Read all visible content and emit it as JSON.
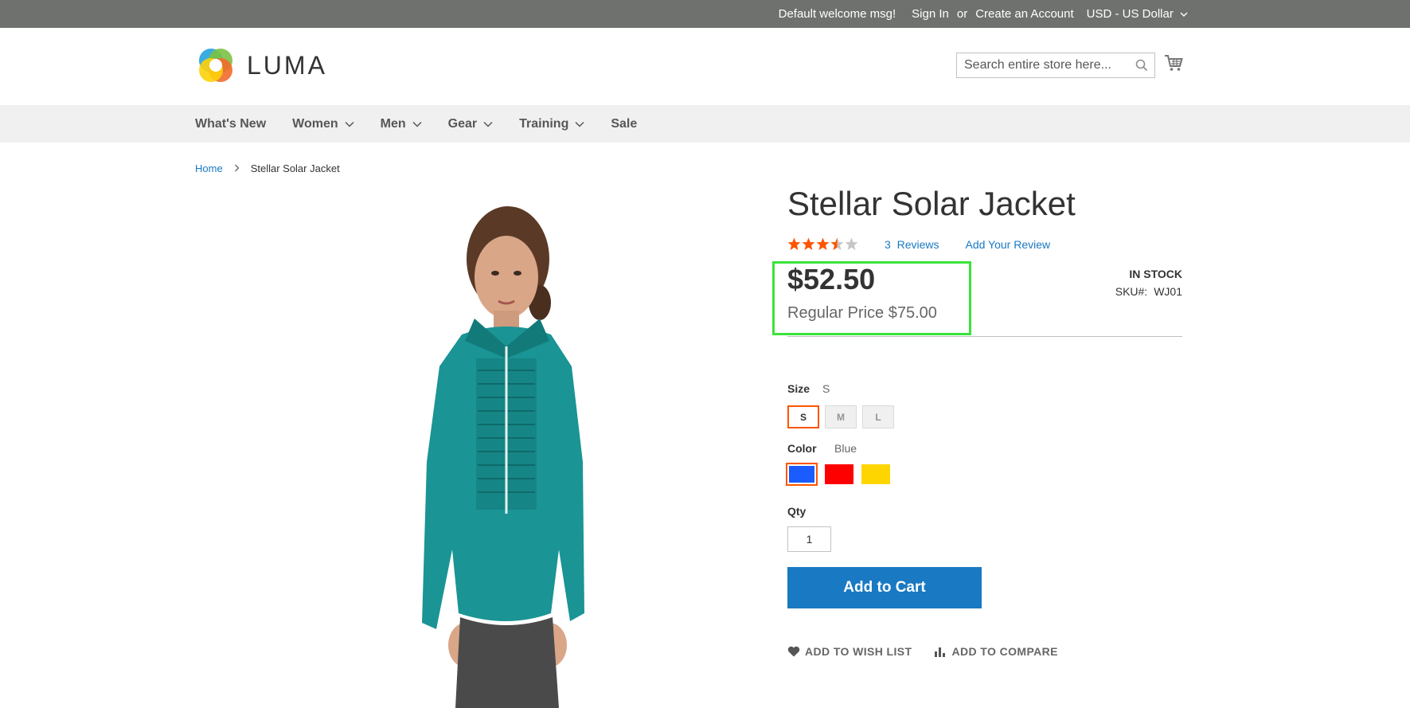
{
  "topbar": {
    "welcome": "Default welcome msg!",
    "sign_in": "Sign In",
    "or": "or",
    "create_account": "Create an Account",
    "currency": "USD - US Dollar"
  },
  "header": {
    "logo_text": "LUMA",
    "search_placeholder": "Search entire store here...",
    "cart_icon": "cart-icon"
  },
  "nav": {
    "items": [
      {
        "label": "What's New",
        "has_dropdown": false
      },
      {
        "label": "Women",
        "has_dropdown": true
      },
      {
        "label": "Men",
        "has_dropdown": true
      },
      {
        "label": "Gear",
        "has_dropdown": true
      },
      {
        "label": "Training",
        "has_dropdown": true
      },
      {
        "label": "Sale",
        "has_dropdown": false
      }
    ]
  },
  "breadcrumb": {
    "home": "Home",
    "separator": ">",
    "current": "Stellar Solar Jacket"
  },
  "product": {
    "title": "Stellar Solar Jacket",
    "rating_stars": 3.5,
    "reviews_count": "3",
    "reviews_label": "Reviews",
    "add_review": "Add Your Review",
    "price": "$52.50",
    "regular_price": "Regular Price $75.00",
    "stock": "IN STOCK",
    "sku_label": "SKU#:",
    "sku_value": "WJ01",
    "size_label": "Size",
    "size_selected": "S",
    "sizes": [
      "S",
      "M",
      "L"
    ],
    "color_label": "Color",
    "color_selected": "Blue",
    "colors": [
      "#1a5cff",
      "#ff0000",
      "#ffd500"
    ],
    "qty_label": "Qty",
    "qty_value": "1",
    "add_to_cart": "Add to Cart",
    "add_to_wishlist": "ADD TO WISH LIST",
    "add_to_compare": "ADD TO COMPARE"
  },
  "colors": {
    "topbar_bg": "#6e716e",
    "nav_bg": "#f0f0f0",
    "link_blue": "#1979c3",
    "selected_outline": "#ff5501",
    "highlight_box": "#3be33b",
    "star_orange": "#ff5501"
  }
}
